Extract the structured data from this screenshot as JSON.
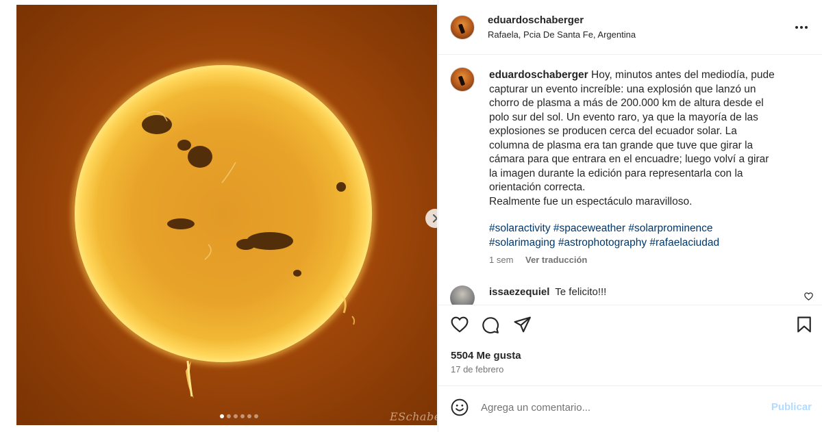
{
  "post": {
    "username": "eduardoschaberger",
    "location": "Rafaela, Pcia De Santa Fe, Argentina",
    "caption_username": "eduardoschaberger",
    "caption_text": "Hoy, minutos antes del mediodía, pude capturar un evento increíble: una explosión que lanzó un chorro de plasma a más de 200.000 km de altura desde el polo sur del sol. Un evento raro, ya que la mayoría de las explosiones se producen cerca del ecuador solar. La columna de plasma era tan grande que tuve que girar la cámara para que entrara en el encuadre; luego volví a girar la imagen durante la edición para representarla con la orientación correcta.",
    "caption_line2": "Realmente fue un espectáculo maravilloso.",
    "hashtags": [
      "#solaractivity",
      "#spaceweather",
      "#solarprominence",
      "#solarimaging",
      "#astrophotography",
      "#rafaelaciudad"
    ],
    "time_ago": "1 sem",
    "translate_label": "Ver traducción",
    "likes": "5504 Me gusta",
    "date": "17 de febrero"
  },
  "comment": {
    "username": "issaezequiel",
    "text": "Te felicito!!!"
  },
  "media": {
    "signature": "ESchaberger",
    "slide_count": 6,
    "active_slide": 1
  },
  "compose": {
    "placeholder": "Agrega un comentario...",
    "publish_label": "Publicar"
  },
  "icons": {
    "more": "more-horizontal-icon",
    "next": "chevron-right-icon",
    "like": "heart-icon",
    "comment": "comment-bubble-icon",
    "share": "send-icon",
    "save": "bookmark-icon",
    "emoji": "emoji-smile-icon"
  },
  "colors": {
    "hashtag": "#00376b",
    "publish_disabled": "#b3dbff",
    "secondary_text": "#737373"
  }
}
